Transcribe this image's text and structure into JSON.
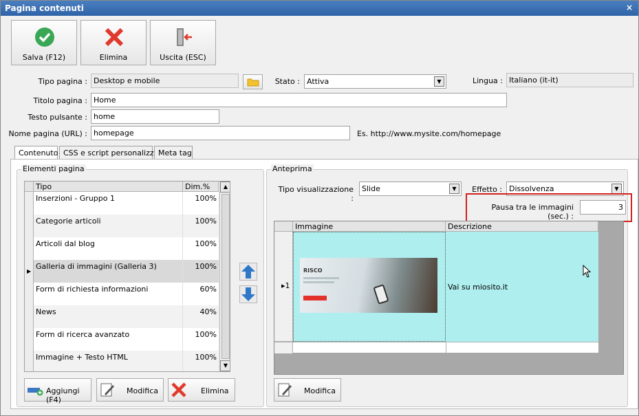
{
  "window": {
    "title": "Pagina contenuti",
    "close_glyph": "×"
  },
  "toolbar": {
    "save": "Salva (F12)",
    "delete": "Elimina",
    "exit": "Uscita (ESC)"
  },
  "form": {
    "tipo_pagina_label": "Tipo pagina :",
    "tipo_pagina_value": "Desktop e mobile",
    "stato_label": "Stato :",
    "stato_value": "Attiva",
    "lingua_label": "Lingua :",
    "lingua_value": "Italiano (it-it)",
    "titolo_label": "Titolo pagina :",
    "titolo_value": "Home",
    "testo_label": "Testo pulsante :",
    "testo_value": "home",
    "nome_label": "Nome pagina (URL) :",
    "nome_value": "homepage",
    "url_hint": "Es. http://www.mysite.com/homepage"
  },
  "tabs": [
    "Contenuto",
    "CSS e script personalizzati",
    "Meta tag"
  ],
  "elementi": {
    "title": "Elementi pagina",
    "col_tipo": "Tipo",
    "col_dim": "Dim.%",
    "rows": [
      {
        "tipo": "Inserzioni - Gruppo 1",
        "dim": "100%"
      },
      {
        "tipo": "Categorie articoli",
        "dim": "100%"
      },
      {
        "tipo": "Articoli dal blog",
        "dim": "100%"
      },
      {
        "tipo": "Galleria di immagini (Galleria 3)",
        "dim": "100%"
      },
      {
        "tipo": "Form di richiesta informazioni",
        "dim": "60%"
      },
      {
        "tipo": "News",
        "dim": "40%"
      },
      {
        "tipo": "Form di ricerca avanzato",
        "dim": "100%"
      },
      {
        "tipo": "Immagine + Testo HTML",
        "dim": "100%"
      }
    ],
    "selected_index": 3,
    "add_button": "Aggiungi (F4)",
    "edit_button": "Modifica",
    "delete_button": "Elimina"
  },
  "anteprima": {
    "title": "Anteprima",
    "tipo_vis_label": "Tipo visualizzazione :",
    "tipo_vis_value": "Slide",
    "effetto_label": "Effetto :",
    "effetto_value": "Dissolvenza",
    "pausa_label": "Pausa tra le immagini (sec.) :",
    "pausa_value": "3",
    "col_immagine": "Immagine",
    "col_descrizione": "Descrizione",
    "row_index": "1",
    "row_descrizione": "Vai su miosito.it",
    "thumb_brand": "RISCO",
    "edit_button": "Modifica"
  },
  "colors": {
    "highlight_box": "#d21f1f",
    "selected_row": "#aeeeee",
    "accent": "#2f63a8"
  }
}
